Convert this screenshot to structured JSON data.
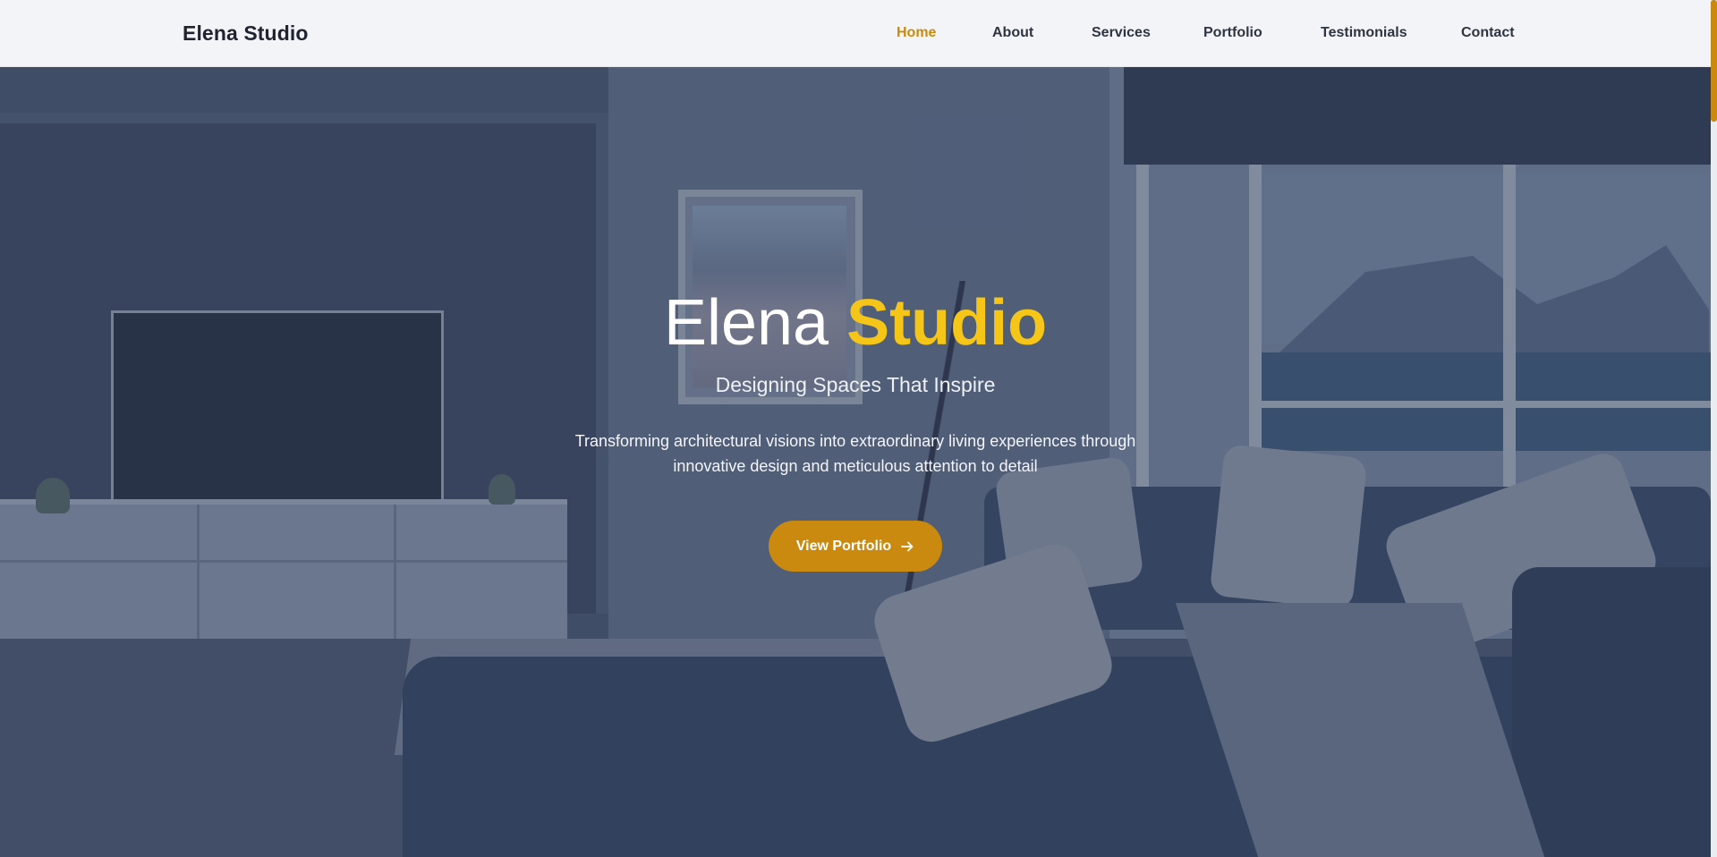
{
  "header": {
    "brand": "Elena Studio",
    "nav": [
      {
        "label": "Home",
        "active": true
      },
      {
        "label": "About",
        "active": false
      },
      {
        "label": "Services",
        "active": false
      },
      {
        "label": "Portfolio",
        "active": false
      },
      {
        "label": "Testimonials",
        "active": false
      },
      {
        "label": "Contact",
        "active": false
      }
    ]
  },
  "hero": {
    "title_light": "Elena",
    "title_accent": "Studio",
    "subtitle": "Designing Spaces That Inspire",
    "description": "Transforming architectural visions into extraordinary living experiences through innovative design and meticulous attention to detail",
    "cta_label": "View Portfolio",
    "cta_icon": "arrow-right-icon",
    "background": "living-room-photo"
  },
  "colors": {
    "accent": "#c98a0f",
    "title_accent": "#f5c518",
    "nav_text": "#2e3440",
    "header_bg": "#f2f4f7"
  }
}
